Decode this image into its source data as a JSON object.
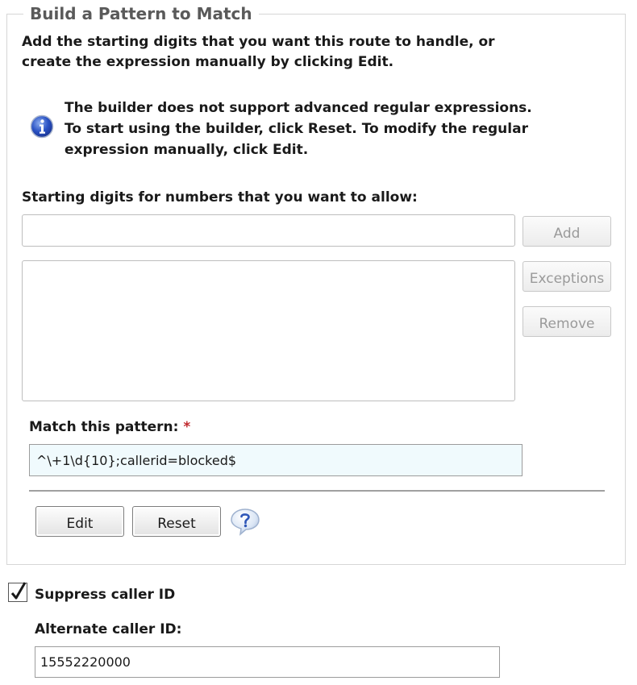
{
  "section": {
    "legend": "Build a Pattern to Match",
    "intro": "Add the starting digits that you want this route to handle, or create the expression manually by clicking Edit.",
    "info_message": "The builder does not support advanced regular expressions. To start using the builder, click Reset. To modify the regular expression manually, click Edit.",
    "info_icon": "info-icon"
  },
  "digits": {
    "label": "Starting digits for numbers that you want to allow:",
    "input_value": "",
    "add_label": "Add",
    "exceptions_label": "Exceptions",
    "remove_label": "Remove",
    "list_items": []
  },
  "pattern": {
    "label": "Match this pattern:",
    "required_marker": "*",
    "value": "^\\+1\\d{10};callerid=blocked$"
  },
  "actions": {
    "edit_label": "Edit",
    "reset_label": "Reset",
    "help_icon": "help-icon"
  },
  "suppress": {
    "label": "Suppress caller ID",
    "checked": true
  },
  "alternate": {
    "label": "Alternate caller ID:",
    "value": "15552220000"
  },
  "colors": {
    "required": "#c0282d",
    "pattern_bg": "#f0fafd",
    "legend_text": "#5a5a5a",
    "disabled_text": "#9a9a9a"
  }
}
